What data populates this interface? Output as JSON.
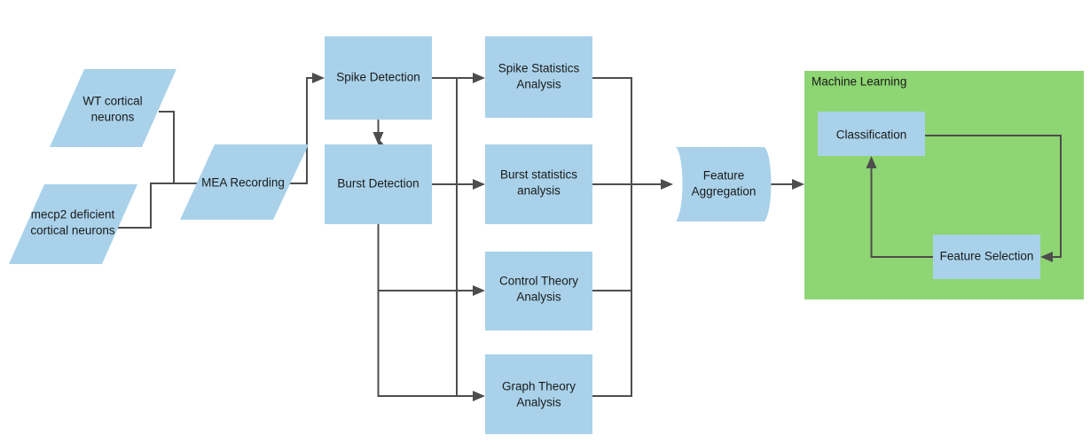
{
  "diagram": {
    "title": "MEA analysis pipeline flowchart",
    "colors": {
      "node_fill": "#a9d2ea",
      "group_fill": "#8ed573",
      "connector": "#4d4d4d",
      "text": "#1a1a1a",
      "background": "#ffffff"
    },
    "nodes": {
      "wt_neurons": {
        "label_line1": "WT cortical",
        "label_line2": "neurons",
        "shape": "parallelogram"
      },
      "mecp2_neurons": {
        "label_line1": "mecp2 deficient",
        "label_line2": "cortical  neurons",
        "shape": "parallelogram"
      },
      "mea_recording": {
        "label_line1": "MEA Recording",
        "label_line2": "",
        "shape": "parallelogram"
      },
      "spike_detection": {
        "label_line1": "Spike Detection",
        "label_line2": "",
        "shape": "rectangle"
      },
      "burst_detection": {
        "label_line1": "Burst Detection",
        "label_line2": "",
        "shape": "rectangle"
      },
      "spike_statistics": {
        "label_line1": "Spike Statistics",
        "label_line2": "Analysis",
        "shape": "rectangle"
      },
      "burst_statistics": {
        "label_line1": "Burst statistics",
        "label_line2": "analysis",
        "shape": "rectangle"
      },
      "control_theory": {
        "label_line1": "Control Theory",
        "label_line2": "Analysis",
        "shape": "rectangle"
      },
      "graph_theory": {
        "label_line1": "Graph Theory",
        "label_line2": "Analysis",
        "shape": "rectangle"
      },
      "feature_aggregation": {
        "label_line1": "Feature",
        "label_line2": "Aggregation",
        "shape": "tape"
      },
      "machine_learning_group": {
        "label_line1": "Machine Learning",
        "label_line2": "",
        "shape": "container"
      },
      "classification": {
        "label_line1": "Classification",
        "label_line2": "",
        "shape": "rectangle"
      },
      "feature_selection": {
        "label_line1": "Feature Selection",
        "label_line2": "",
        "shape": "rectangle"
      }
    }
  }
}
